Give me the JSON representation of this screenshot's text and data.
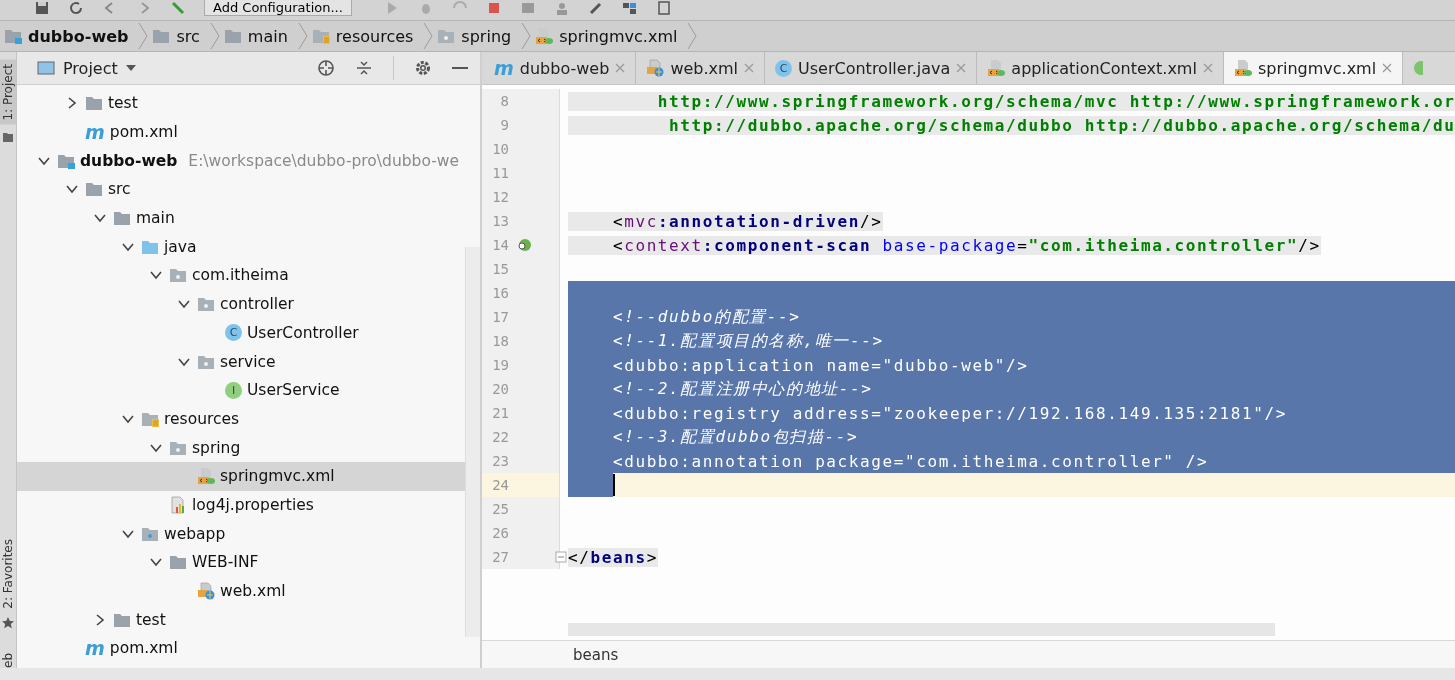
{
  "toolbar": {
    "run_config": "Add Configuration..."
  },
  "breadcrumbs": [
    {
      "label": "dubbo-web",
      "kind": "module"
    },
    {
      "label": "src",
      "kind": "folder"
    },
    {
      "label": "main",
      "kind": "folder"
    },
    {
      "label": "resources",
      "kind": "resource"
    },
    {
      "label": "spring",
      "kind": "package"
    },
    {
      "label": "springmvc.xml",
      "kind": "xml"
    }
  ],
  "tool_strip": {
    "top": "1: Project",
    "bottom": "2: Favorites",
    "cut": "eb"
  },
  "project_panel": {
    "title": "Project"
  },
  "tree": {
    "above_items": [
      {
        "label": "test",
        "kind": "folder",
        "expanded": false,
        "selected": false
      },
      {
        "label": "pom.xml",
        "kind": "maven",
        "icon_letter": "m",
        "selected": false
      }
    ],
    "items": [
      {
        "label": "dubbo-web",
        "path": "E:\\workspace\\dubbo-pro\\dubbo-we",
        "kind": "module",
        "expanded": true,
        "selected": false,
        "children": [
          {
            "label": "src",
            "kind": "folder",
            "expanded": true,
            "selected": false,
            "children": [
              {
                "label": "main",
                "kind": "folder",
                "expanded": true,
                "selected": false,
                "children": [
                  {
                    "label": "java",
                    "kind": "source",
                    "expanded": true,
                    "selected": false,
                    "children": [
                      {
                        "label": "com.itheima",
                        "kind": "package",
                        "expanded": true,
                        "selected": false,
                        "children": [
                          {
                            "label": "controller",
                            "kind": "package",
                            "expanded": true,
                            "selected": false,
                            "children": [
                              {
                                "label": "UserController",
                                "kind": "class",
                                "icon_letter": "C",
                                "selected": false
                              }
                            ]
                          },
                          {
                            "label": "service",
                            "kind": "package",
                            "expanded": true,
                            "selected": false,
                            "children": [
                              {
                                "label": "UserService",
                                "kind": "interface",
                                "icon_letter": "I",
                                "selected": false
                              }
                            ]
                          }
                        ]
                      }
                    ]
                  },
                  {
                    "label": "resources",
                    "kind": "resource",
                    "expanded": true,
                    "selected": false,
                    "children": [
                      {
                        "label": "spring",
                        "kind": "package",
                        "expanded": true,
                        "selected": false,
                        "children": [
                          {
                            "label": "springmvc.xml",
                            "kind": "xml",
                            "selected": true
                          }
                        ]
                      },
                      {
                        "label": "log4j.properties",
                        "kind": "properties",
                        "selected": false
                      }
                    ]
                  },
                  {
                    "label": "webapp",
                    "kind": "web",
                    "expanded": true,
                    "selected": false,
                    "children": [
                      {
                        "label": "WEB-INF",
                        "kind": "folder",
                        "expanded": true,
                        "selected": false,
                        "children": [
                          {
                            "label": "web.xml",
                            "kind": "webxml",
                            "selected": false
                          }
                        ]
                      }
                    ]
                  }
                ]
              },
              {
                "label": "test",
                "kind": "folder",
                "expanded": false,
                "selected": false
              }
            ]
          },
          {
            "label": "pom.xml",
            "kind": "maven",
            "icon_letter": "m",
            "selected": false
          }
        ]
      }
    ]
  },
  "tabs": [
    {
      "label": "dubbo-web",
      "kind": "maven",
      "icon_letter": "m",
      "selected": false
    },
    {
      "label": "web.xml",
      "kind": "webxml",
      "selected": false
    },
    {
      "label": "UserController.java",
      "kind": "class",
      "icon_letter": "C",
      "selected": false
    },
    {
      "label": "applicationContext.xml",
      "kind": "xml",
      "selected": false
    },
    {
      "label": "springmvc.xml",
      "kind": "xml",
      "selected": true
    }
  ],
  "code_lines": [
    {
      "number": "8",
      "highlighted": true,
      "selected": false,
      "current": false,
      "segments": [
        {
          "text": "        http://www.springframework.org/schema/mvc http://www.springframework.or",
          "kind": "url"
        }
      ]
    },
    {
      "number": "9",
      "highlighted": true,
      "selected": false,
      "current": false,
      "segments": [
        {
          "text": "         http://dubbo.apache.org/schema/dubbo http://dubbo.apache.org/schema/du",
          "kind": "url"
        }
      ]
    },
    {
      "number": "10",
      "selected": false,
      "current": false
    },
    {
      "number": "11",
      "selected": false,
      "current": false
    },
    {
      "number": "12",
      "selected": false,
      "current": false
    },
    {
      "number": "13",
      "highlighted": true,
      "selected": false,
      "current": false,
      "segments": [
        {
          "text": "    <",
          "kind": "punct"
        },
        {
          "text": "mvc",
          "kind": "ns"
        },
        {
          "text": ":annotation-driven",
          "kind": "tag"
        },
        {
          "text": "/>",
          "kind": "punct"
        }
      ]
    },
    {
      "number": "14",
      "highlighted": true,
      "selected": false,
      "current": false,
      "kind": "bean",
      "segments": [
        {
          "text": "    <",
          "kind": "punct"
        },
        {
          "text": "context",
          "kind": "ns"
        },
        {
          "text": ":component-scan ",
          "kind": "tag"
        },
        {
          "text": "base-package",
          "kind": "attr"
        },
        {
          "text": "=",
          "kind": "punct"
        },
        {
          "text": "\"com.itheima.controller\"",
          "kind": "value"
        },
        {
          "text": "/>",
          "kind": "punct"
        }
      ]
    },
    {
      "number": "15",
      "selected": false,
      "current": false
    },
    {
      "number": "16",
      "selected": true,
      "current": false
    },
    {
      "number": "17",
      "highlighted": false,
      "selected": true,
      "current": false,
      "segments": [
        {
          "text": "    <!--dubbo的配置-->",
          "kind": "comment"
        }
      ]
    },
    {
      "number": "18",
      "highlighted": false,
      "selected": true,
      "current": false,
      "segments": [
        {
          "text": "    <!--1.配置项目的名称,唯一-->",
          "kind": "comment"
        }
      ]
    },
    {
      "number": "19",
      "highlighted": false,
      "selected": true,
      "current": false,
      "segments": [
        {
          "text": "    <",
          "kind": "punct"
        },
        {
          "text": "dubbo",
          "kind": "ns"
        },
        {
          "text": ":application ",
          "kind": "tag"
        },
        {
          "text": "name",
          "kind": "attr"
        },
        {
          "text": "=",
          "kind": "punct"
        },
        {
          "text": "\"dubbo-web\"",
          "kind": "value"
        },
        {
          "text": "/>",
          "kind": "punct"
        }
      ]
    },
    {
      "number": "20",
      "highlighted": false,
      "selected": true,
      "current": false,
      "segments": [
        {
          "text": "    <!--2.配置注册中心的地址-->",
          "kind": "comment"
        }
      ]
    },
    {
      "number": "21",
      "highlighted": false,
      "selected": true,
      "current": false,
      "segments": [
        {
          "text": "    <",
          "kind": "punct"
        },
        {
          "text": "dubbo",
          "kind": "ns"
        },
        {
          "text": ":registry ",
          "kind": "tag"
        },
        {
          "text": "address",
          "kind": "attr"
        },
        {
          "text": "=",
          "kind": "punct"
        },
        {
          "text": "\"zookeeper://192.168.149.135:2181\"",
          "kind": "value"
        },
        {
          "text": "/>",
          "kind": "punct"
        }
      ]
    },
    {
      "number": "22",
      "highlighted": false,
      "selected": true,
      "current": false,
      "segments": [
        {
          "text": "    <!--3.配置dubbo包扫描-->",
          "kind": "comment"
        }
      ]
    },
    {
      "number": "23",
      "highlighted": false,
      "selected": true,
      "current": false,
      "segments": [
        {
          "text": "    <",
          "kind": "punct"
        },
        {
          "text": "dubbo",
          "kind": "ns"
        },
        {
          "text": ":annotation ",
          "kind": "tag"
        },
        {
          "text": "package",
          "kind": "attr"
        },
        {
          "text": "=",
          "kind": "punct"
        },
        {
          "text": "\"com.itheima.controller\"",
          "kind": "value"
        },
        {
          "text": " />",
          "kind": "punct"
        }
      ]
    },
    {
      "number": "24",
      "selected": true,
      "current": true
    },
    {
      "number": "25",
      "selected": false,
      "current": false
    },
    {
      "number": "26",
      "selected": false,
      "current": false
    },
    {
      "number": "27",
      "highlighted": true,
      "selected": false,
      "current": false,
      "kind": "fold",
      "segments": [
        {
          "text": "</",
          "kind": "punct"
        },
        {
          "text": "beans",
          "kind": "tag"
        },
        {
          "text": ">",
          "kind": "punct"
        }
      ]
    }
  ],
  "editor_breadcrumb": "beans"
}
